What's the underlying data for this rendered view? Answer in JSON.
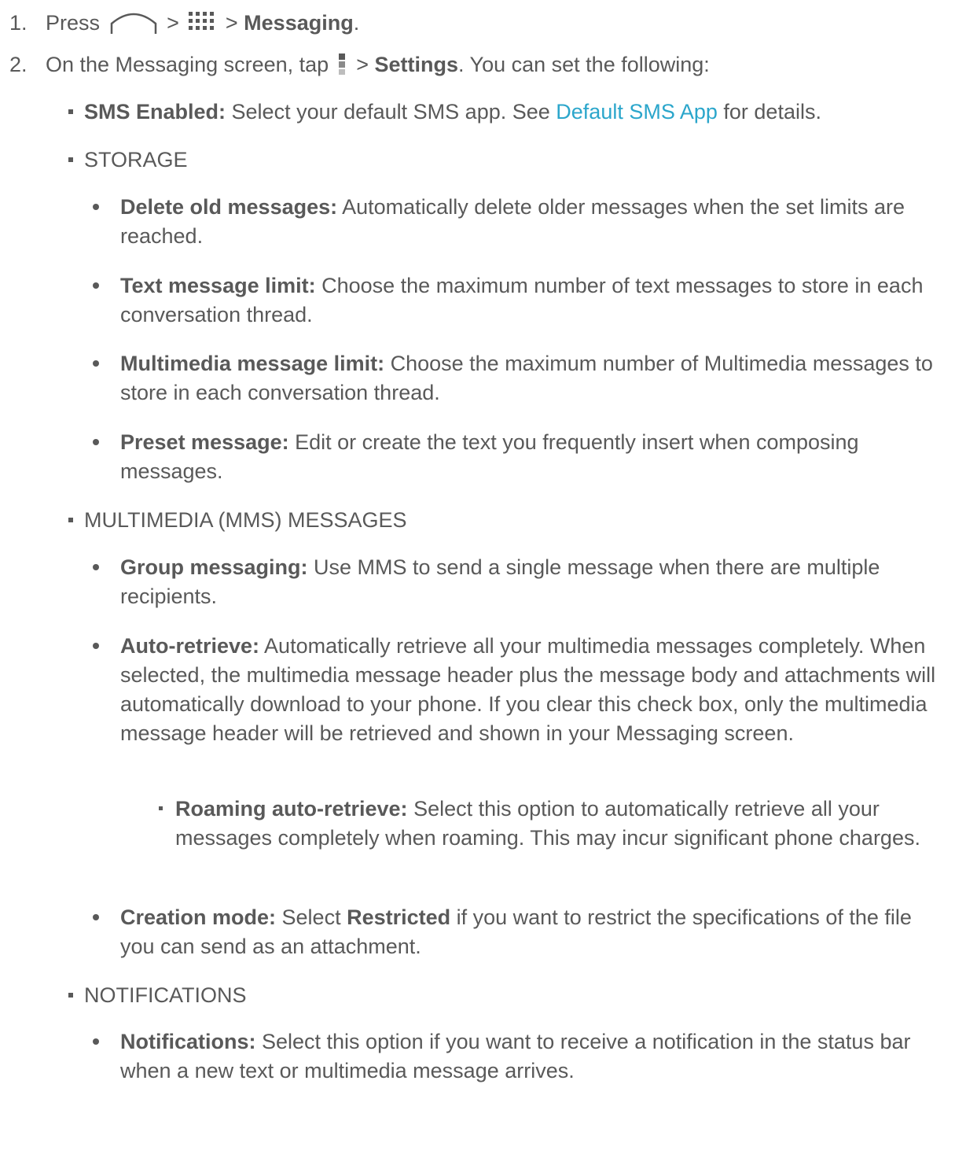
{
  "steps": [
    {
      "num": "1.",
      "pre": "Press",
      "sep1": ">",
      "sep2": ">",
      "bold": "Messaging",
      "post": "."
    },
    {
      "num": "2.",
      "pre": "On the Messaging screen, tap",
      "sep": ">",
      "bold": "Settings",
      "post": ". You can set the following:"
    }
  ],
  "sms": {
    "label": "SMS Enabled:",
    "text_before": " Select your default SMS app. See ",
    "link": "Default SMS App",
    "text_after": " for details."
  },
  "storage": {
    "heading": "STORAGE",
    "items": [
      {
        "label": "Delete old messages:",
        "text": " Automatically delete older messages when the set limits are reached."
      },
      {
        "label": "Text message limit:",
        "text": " Choose the maximum number of text messages to store in each conversation thread."
      },
      {
        "label": "Multimedia message limit:",
        "text": " Choose the maximum number of Multimedia messages to store in each conversation thread."
      },
      {
        "label": "Preset message:",
        "text": " Edit or create the text you frequently insert when composing messages."
      }
    ]
  },
  "mms": {
    "heading": "MULTIMEDIA (MMS) MESSAGES",
    "group": {
      "label": "Group messaging:",
      "text": " Use MMS to send a single message when there are multiple recipients."
    },
    "auto": {
      "label": "Auto-retrieve:",
      "text": " Automatically retrieve all your multimedia messages completely. When selected, the multimedia message header plus the message body and attachments will automatically download to your phone. If you clear this check box, only the multimedia message header will be retrieved and shown in your Messaging screen."
    },
    "roaming": {
      "label": "Roaming auto-retrieve:",
      "text": " Select this option to automatically retrieve all your messages completely when roaming. This may incur significant phone charges."
    },
    "creation": {
      "label": "Creation mode:",
      "text_before": " Select ",
      "bold2": "Restricted",
      "text_after": " if you want to restrict the specifications of the file you can send as an attachment."
    }
  },
  "notifications": {
    "heading": "NOTIFICATIONS",
    "item": {
      "label": "Notifications:",
      "text": " Select this option if you want to receive a notification in the status bar when a new text or multimedia message arrives."
    }
  },
  "icons": {
    "home": "home-icon",
    "apps": "apps-icon",
    "menu": "menu-icon"
  },
  "colors": {
    "text": "#595959",
    "link": "#2ba6cb"
  }
}
